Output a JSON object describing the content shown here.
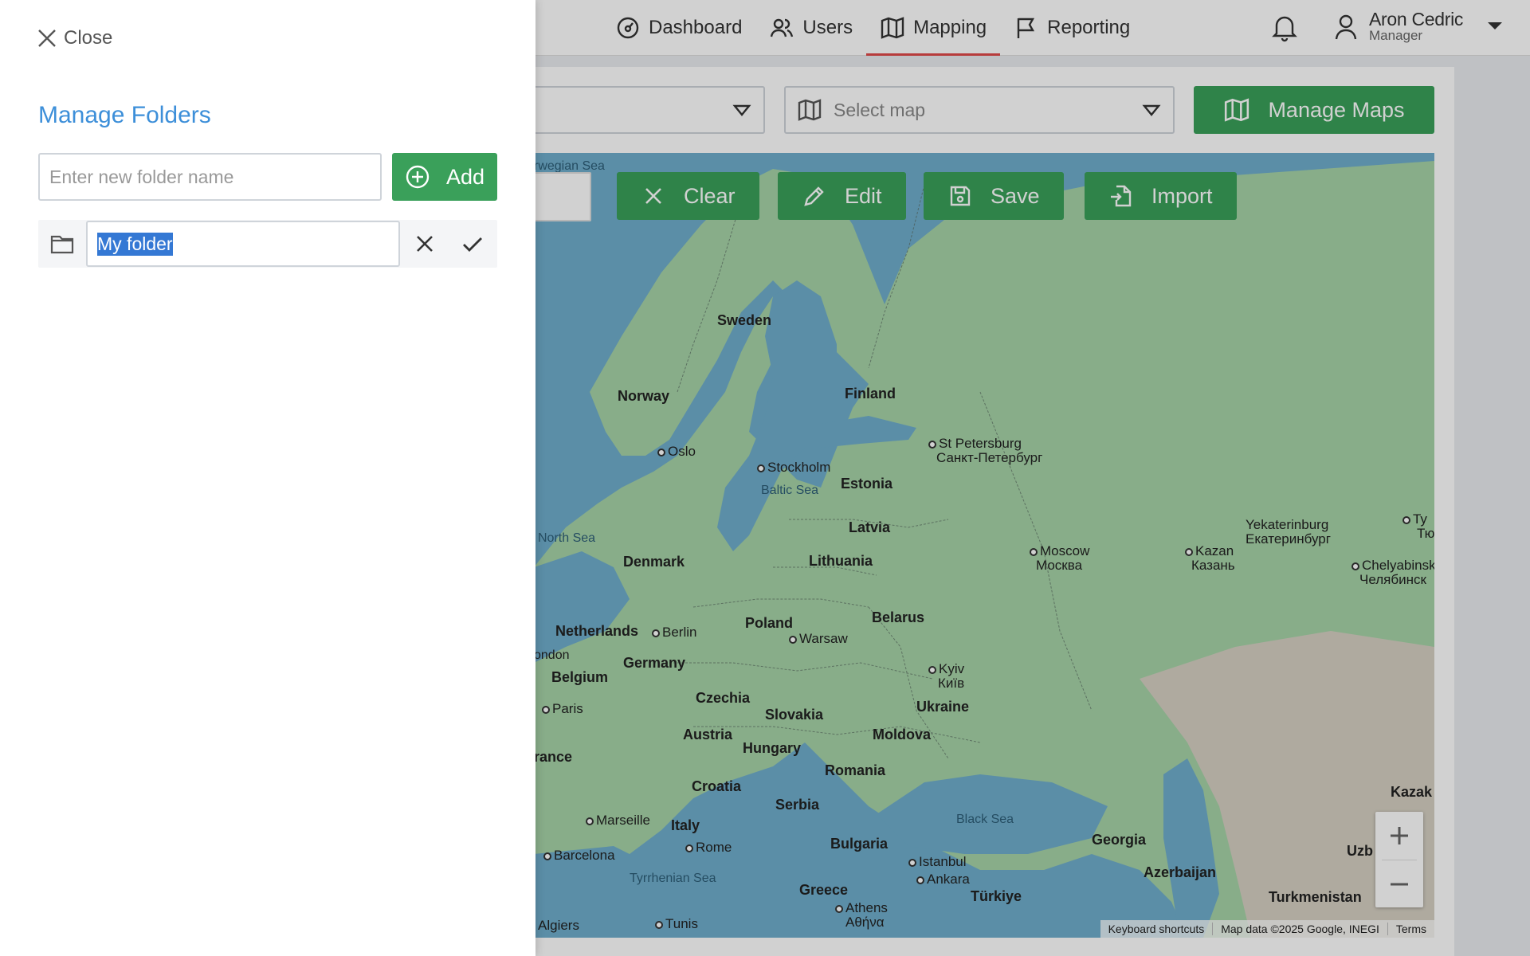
{
  "nav": {
    "items": [
      {
        "label": "Dashboard",
        "icon": "gauge-icon"
      },
      {
        "label": "Users",
        "icon": "users-icon"
      },
      {
        "label": "Mapping",
        "icon": "map-icon",
        "active": true
      },
      {
        "label": "Reporting",
        "icon": "flag-icon"
      }
    ],
    "active_color": "#e04a4a"
  },
  "user": {
    "name": "Aron Cedric",
    "role": "Manager"
  },
  "toolbar": {
    "select_map_placeholder": "Select map",
    "manage_maps_label": "Manage Maps"
  },
  "map_toolbar": {
    "clear_label": "Clear",
    "edit_label": "Edit",
    "save_label": "Save",
    "import_label": "Import"
  },
  "map": {
    "countries": [
      "Sweden",
      "Norway",
      "Finland",
      "Estonia",
      "Latvia",
      "Lithuania",
      "Denmark",
      "Netherlands",
      "Belgium",
      "Germany",
      "Poland",
      "Belarus",
      "Czechia",
      "Slovakia",
      "Austria",
      "Hungary",
      "Ukraine",
      "Moldova",
      "Romania",
      "Croatia",
      "Serbia",
      "Bulgaria",
      "Italy",
      "Greece",
      "Georgia",
      "Azerbaijan",
      "Türkiye",
      "Turkmenistan",
      "rance",
      "Kazak",
      "Uzb"
    ],
    "cities": [
      "Oslo",
      "Stockholm",
      "Berlin",
      "Warsaw",
      "Kyiv",
      "Київ",
      "Paris",
      "ondon",
      "Marseille",
      "Barcelona",
      "Rome",
      "Istanbul",
      "Ankara",
      "Athens",
      "Αθήνα",
      "Tunis",
      "Algiers",
      "St Petersburg",
      "Санкт-Петербург",
      "Moscow",
      "Москва",
      "Kazan",
      "Казань",
      "Yekaterinburg",
      "Екатеринбург",
      "Chelyabinsk",
      "Челябинск",
      "Ту",
      "Тю"
    ],
    "seas": [
      "rwegian Sea",
      "North Sea",
      "Baltic Sea",
      "Black Sea",
      "Tyrrhenian Sea"
    ],
    "attribution": [
      "Keyboard shortcuts",
      "Map data ©2025 Google, INEGI",
      "Terms"
    ],
    "water_color": "#6faecc",
    "land_color": "#a6d4a8"
  },
  "drawer": {
    "close_label": "Close",
    "title": "Manage Folders",
    "new_folder_placeholder": "Enter new folder name",
    "add_label": "Add",
    "folders": [
      {
        "name": "My folder",
        "editing": true
      }
    ],
    "title_color": "#3d8fd9",
    "accent_color": "#3aa05a"
  }
}
